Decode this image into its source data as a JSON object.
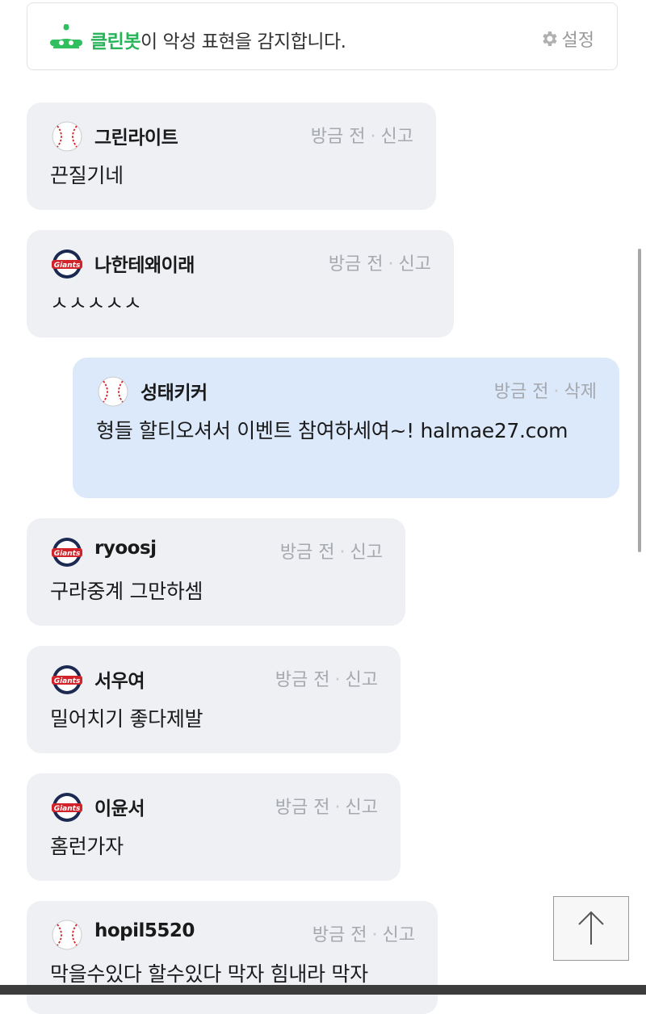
{
  "banner": {
    "bot_name": "클린봇",
    "message": "이 악성 표현을 감지합니다.",
    "settings_label": "설정"
  },
  "comments": [
    {
      "user": "그린라이트",
      "avatar": "baseball-icon",
      "time": "방금 전",
      "action": "신고",
      "text": "끈질기네",
      "mine": false
    },
    {
      "user": "나한테왜이래",
      "avatar": "giants-logo",
      "time": "방금 전",
      "action": "신고",
      "text": "ㅅㅅㅅㅅㅅ",
      "mine": false
    },
    {
      "user": "성태키커",
      "avatar": "baseball-icon",
      "time": "방금 전",
      "action": "삭제",
      "text": "형들 할티오셔서 이벤트 참여하세여~! halmae27.com",
      "mine": true
    },
    {
      "user": "ryoosj",
      "avatar": "giants-logo",
      "time": "방금 전",
      "action": "신고",
      "text": "구라중계 그만하셈",
      "mine": false
    },
    {
      "user": "서우여",
      "avatar": "giants-logo",
      "time": "방금 전",
      "action": "신고",
      "text": "밀어치기 좋다제발",
      "mine": false
    },
    {
      "user": "이윤서",
      "avatar": "giants-logo",
      "time": "방금 전",
      "action": "신고",
      "text": "홈런가자",
      "mine": false
    },
    {
      "user": "hopil5520",
      "avatar": "baseball-icon",
      "time": "방금 전",
      "action": "신고",
      "text": "막을수있다 할수있다 막자 힘내라 막자",
      "mine": false
    }
  ],
  "colors": {
    "bot_green": "#27b35a",
    "bubble_other": "#eef0f4",
    "bubble_mine": "#dbe9fb",
    "meta_gray": "#a5a8ae"
  },
  "scroll_top": {
    "icon": "arrow-up-icon"
  }
}
